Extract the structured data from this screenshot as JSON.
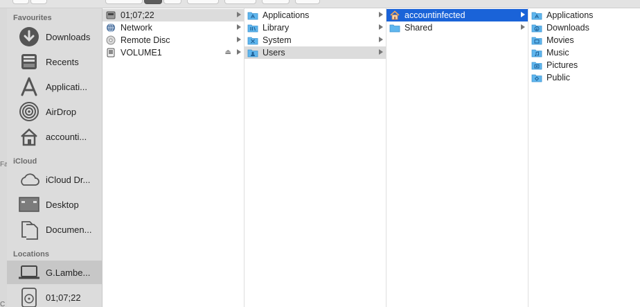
{
  "sidebar": {
    "sections": [
      {
        "label": "Favourites"
      },
      {
        "label": "iCloud"
      },
      {
        "label": "Locations"
      }
    ],
    "items": [
      {
        "label": "Downloads",
        "icon": "download-circle-icon"
      },
      {
        "label": "Recents",
        "icon": "recents-tray-icon"
      },
      {
        "label": "Applicati...",
        "icon": "applications-icon"
      },
      {
        "label": "AirDrop",
        "icon": "airdrop-icon"
      },
      {
        "label": "accounti...",
        "icon": "home-icon"
      },
      {
        "label": "iCloud Dr...",
        "icon": "cloud-icon"
      },
      {
        "label": "Desktop",
        "icon": "desktop-icon"
      },
      {
        "label": "Documen...",
        "icon": "documents-icon"
      },
      {
        "label": "G.Lambe...",
        "icon": "laptop-icon"
      },
      {
        "label": "01;07;22",
        "icon": "disk-icon"
      }
    ]
  },
  "columns": [
    {
      "rows": [
        {
          "label": "01;07;22",
          "icon": "disk-icon"
        },
        {
          "label": "Network",
          "icon": "globe-icon"
        },
        {
          "label": "Remote Disc",
          "icon": "disc-icon"
        },
        {
          "label": "VOLUME1",
          "icon": "usb-drive-icon"
        }
      ]
    },
    {
      "rows": [
        {
          "label": "Applications",
          "icon": "applications-folder-icon"
        },
        {
          "label": "Library",
          "icon": "library-folder-icon"
        },
        {
          "label": "System",
          "icon": "system-folder-icon"
        },
        {
          "label": "Users",
          "icon": "users-folder-icon"
        }
      ]
    },
    {
      "rows": [
        {
          "label": "accountinfected",
          "icon": "home-icon"
        },
        {
          "label": "Shared",
          "icon": "folder-icon"
        }
      ]
    },
    {
      "rows": [
        {
          "label": "Applications",
          "icon": "applications-folder-icon"
        },
        {
          "label": "Downloads",
          "icon": "downloads-folder-icon"
        },
        {
          "label": "Movies",
          "icon": "movies-folder-icon"
        },
        {
          "label": "Music",
          "icon": "music-folder-icon"
        },
        {
          "label": "Pictures",
          "icon": "pictures-folder-icon"
        },
        {
          "label": "Public",
          "icon": "public-folder-icon"
        }
      ]
    }
  ],
  "background_window": {
    "fragments": [
      "Fa",
      "C"
    ]
  },
  "colors": {
    "selection_blue": "#1a63d8",
    "folder_blue": "#5fb6ee",
    "sidebar_bg": "#dcdcdc"
  }
}
